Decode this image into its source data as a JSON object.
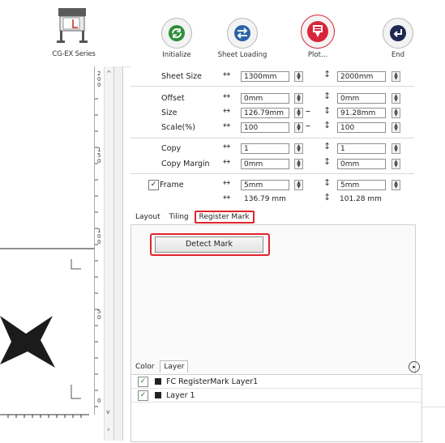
{
  "device": {
    "label": "CG-EX Series"
  },
  "toolbar": {
    "initialize": "Initialize",
    "sheet_loading": "Sheet Loading",
    "plot": "Plot...",
    "end": "End"
  },
  "ruler": {
    "labels": [
      "2",
      "0",
      "0",
      "1",
      "5",
      "0",
      "1",
      "0",
      "0",
      "5",
      "0",
      "0"
    ]
  },
  "settings": {
    "sheet_size": {
      "label": "Sheet Size",
      "width": "1300mm",
      "height": "2000mm"
    },
    "offset": {
      "label": "Offset",
      "width": "0mm",
      "height": "0mm"
    },
    "size": {
      "label": "Size",
      "width": "126.79mm",
      "height": "91.28mm"
    },
    "scale": {
      "label": "Scale(%)",
      "width": "100",
      "height": "100"
    },
    "copy": {
      "label": "Copy",
      "width": "1",
      "height": "1"
    },
    "copy_margin": {
      "label": "Copy Margin",
      "width": "0mm",
      "height": "0mm"
    },
    "frame": {
      "label": "Frame",
      "checked": true,
      "width": "5mm",
      "height": "5mm"
    },
    "total": {
      "width": "136.79 mm",
      "height": "101.28 mm"
    }
  },
  "tabs": {
    "layout": "Layout",
    "tiling": "Tiling",
    "register_mark": "Register Mark"
  },
  "register": {
    "detect_button": "Detect Mark"
  },
  "layer_panel": {
    "tabs": {
      "color": "Color",
      "layer": "Layer"
    },
    "layers": [
      {
        "name": "FC RegisterMark Layer1",
        "checked": true
      },
      {
        "name": "Layer 1",
        "checked": true
      }
    ]
  },
  "colors": {
    "accent_red": "#e0242a",
    "plot_red": "#d9253a",
    "initialize_green": "#2f8f3a",
    "sheet_blue": "#2c63a8"
  }
}
